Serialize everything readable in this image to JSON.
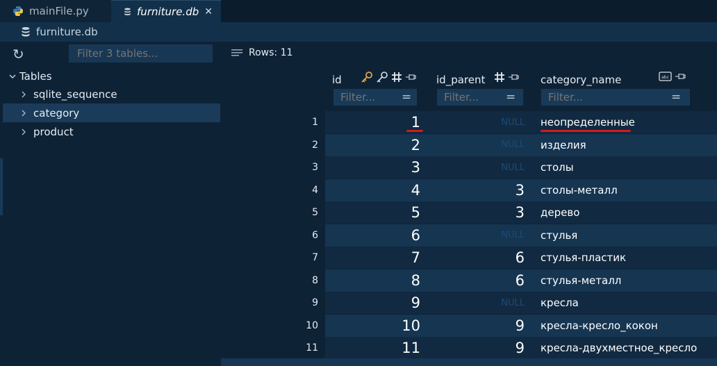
{
  "tabs": [
    {
      "label": "mainFile.py",
      "icon": "python-icon",
      "active": false
    },
    {
      "label": "furniture.db",
      "icon": "database-icon",
      "active": true,
      "close": "✕"
    }
  ],
  "breadcrumb": {
    "label": "furniture.db",
    "icon": "database-icon"
  },
  "sidebar": {
    "refresh_icon": "↻",
    "filter_placeholder": "Filter 3 tables...",
    "root_label": "Tables",
    "items": [
      {
        "label": "sqlite_sequence",
        "selected": false
      },
      {
        "label": "category",
        "selected": true
      },
      {
        "label": "product",
        "selected": false
      }
    ]
  },
  "grid": {
    "rows_label": "Rows: 11",
    "columns": [
      {
        "name": "id",
        "filter_placeholder": "Filter...",
        "icons": [
          "primary-key-icon",
          "key-icon",
          "hash-icon",
          "pin-icon"
        ]
      },
      {
        "name": "id_parent",
        "filter_placeholder": "Filter...",
        "icons": [
          "hash-icon",
          "pin-icon"
        ]
      },
      {
        "name": "category_name",
        "filter_placeholder": "Filter...",
        "icons": [
          "text-type-icon",
          "pin-icon"
        ]
      }
    ],
    "rows": [
      {
        "num": "1",
        "id": "1",
        "id_parent": "NULL",
        "category_name": "неопределенные"
      },
      {
        "num": "2",
        "id": "2",
        "id_parent": "NULL",
        "category_name": "изделия"
      },
      {
        "num": "3",
        "id": "3",
        "id_parent": "NULL",
        "category_name": "столы"
      },
      {
        "num": "4",
        "id": "4",
        "id_parent": "3",
        "category_name": "столы-металл"
      },
      {
        "num": "5",
        "id": "5",
        "id_parent": "3",
        "category_name": "дерево"
      },
      {
        "num": "6",
        "id": "6",
        "id_parent": "NULL",
        "category_name": "стулья"
      },
      {
        "num": "7",
        "id": "7",
        "id_parent": "6",
        "category_name": "стулья-пластик"
      },
      {
        "num": "8",
        "id": "8",
        "id_parent": "6",
        "category_name": "стулья-металл"
      },
      {
        "num": "9",
        "id": "9",
        "id_parent": "NULL",
        "category_name": "кресла"
      },
      {
        "num": "10",
        "id": "10",
        "id_parent": "9",
        "category_name": "кресла-кресло_кокон"
      },
      {
        "num": "11",
        "id": "11",
        "id_parent": "9",
        "category_name": "кресла-двухместное_кресло"
      }
    ]
  },
  "colors": {
    "annotation": "#d11b1b",
    "key": "#e0a34b",
    "background": "#0e2236"
  }
}
